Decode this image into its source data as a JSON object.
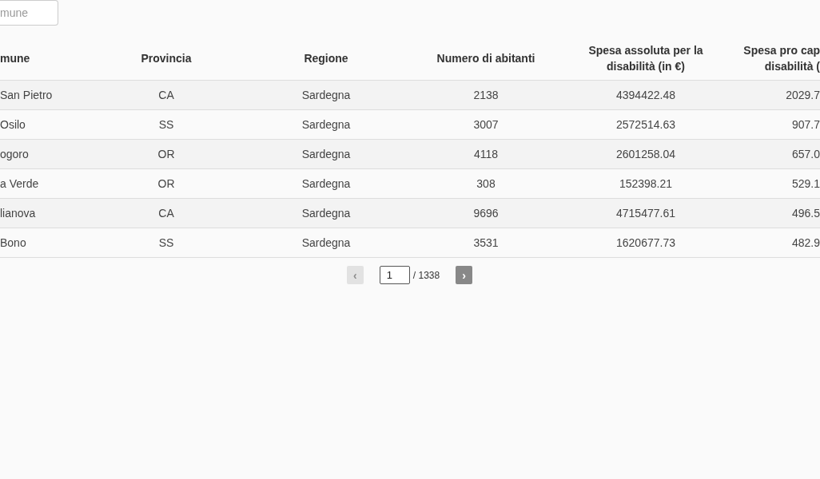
{
  "search": {
    "placeholder": "mune"
  },
  "table": {
    "columns": [
      "mune",
      "Provincia",
      "Regione",
      "Numero di abitanti",
      "Spesa assoluta per la disabilità (in €)",
      "Spesa pro cap disabilità ("
    ],
    "rows": [
      [
        "San Pietro",
        "CA",
        "Sardegna",
        "2138",
        "4394422.48",
        "2029.7"
      ],
      [
        "Osilo",
        "SS",
        "Sardegna",
        "3007",
        "2572514.63",
        "907.7"
      ],
      [
        "ogoro",
        "OR",
        "Sardegna",
        "4118",
        "2601258.04",
        "657.0"
      ],
      [
        "a Verde",
        "OR",
        "Sardegna",
        "308",
        "152398.21",
        "529.1"
      ],
      [
        "lianova",
        "CA",
        "Sardegna",
        "9696",
        "4715477.61",
        "496.5"
      ],
      [
        "Bono",
        "SS",
        "Sardegna",
        "3531",
        "1620677.73",
        "482.9"
      ]
    ]
  },
  "pagination": {
    "prev": {
      "label": "‹",
      "disabled": true
    },
    "page": "1",
    "total": "/ 1338",
    "next": {
      "label": "›",
      "disabled": false
    }
  }
}
